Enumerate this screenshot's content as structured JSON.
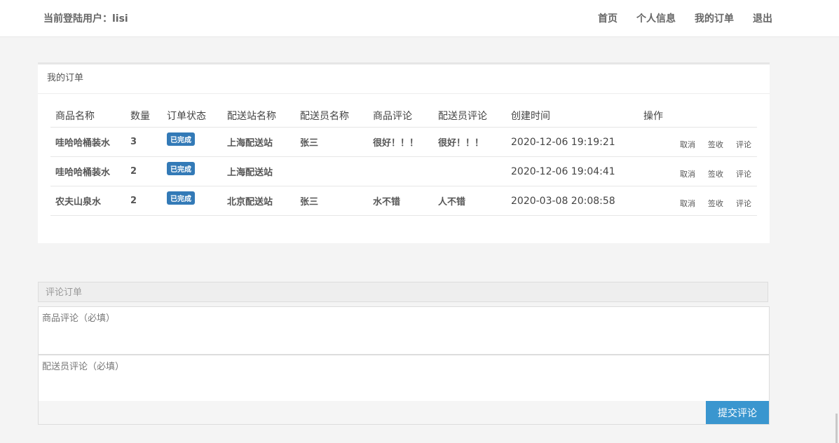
{
  "header": {
    "user_label": "当前登陆用户：lisi",
    "nav": [
      "首页",
      "个人信息",
      "我的订单",
      "退出"
    ]
  },
  "orders_panel": {
    "title": "我的订单",
    "columns": [
      "商品名称",
      "数量",
      "订单状态",
      "配送站名称",
      "配送员名称",
      "商品评论",
      "配送员评论",
      "创建时间",
      "操作"
    ],
    "rows": [
      {
        "product": "哇哈哈桶装水",
        "qty": "3",
        "status": "已完成",
        "station": "上海配送站",
        "courier": "张三",
        "product_review": "很好！！！",
        "courier_review": "很好！！！",
        "created": "2020-12-06 19:19:21"
      },
      {
        "product": "哇哈哈桶装水",
        "qty": "2",
        "status": "已完成",
        "station": "上海配送站",
        "courier": "",
        "product_review": "",
        "courier_review": "",
        "created": "2020-12-06 19:04:41"
      },
      {
        "product": "农夫山泉水",
        "qty": "2",
        "status": "已完成",
        "station": "北京配送站",
        "courier": "张三",
        "product_review": "水不错",
        "courier_review": "人不错",
        "created": "2020-03-08 20:08:58"
      }
    ],
    "actions": [
      "取消",
      "签收",
      "评论"
    ]
  },
  "review_form": {
    "title": "评论订单",
    "product_review_placeholder": "商品评论（必填）",
    "courier_review_placeholder": "配送员评论（必填）",
    "submit_label": "提交评论"
  },
  "colors": {
    "accent": "#3a96cf",
    "badge": "#337ab7"
  }
}
